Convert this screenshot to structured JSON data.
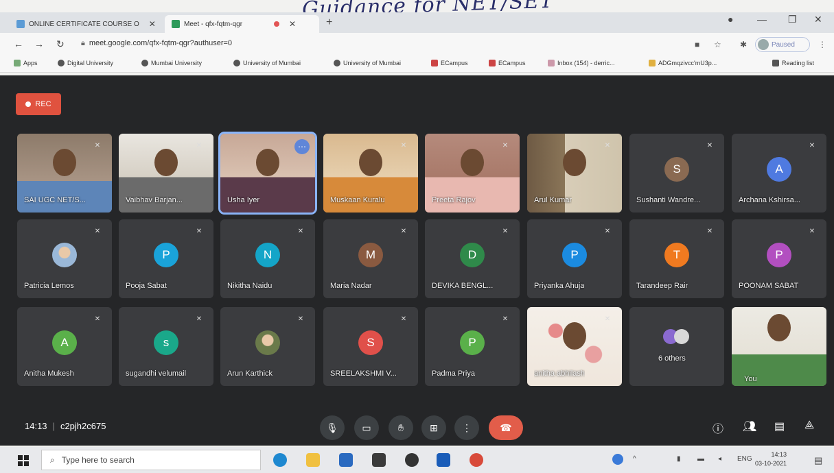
{
  "handwriting": "Guidance for NET/SET",
  "browser": {
    "tabs": [
      {
        "label": "ONLINE CERTIFICATE COURSE O",
        "favicon": "doc-icon",
        "color": "#5b9bd5"
      },
      {
        "label": "Meet - qfx-fqtm-qgr",
        "favicon": "meet-icon",
        "color": "#2e9a5a"
      }
    ],
    "url": "meet.google.com/qfx-fqtm-qgr?authuser=0",
    "profile_label": "Paused",
    "bookmarks": [
      {
        "label": "Apps",
        "icon": "apps-grid-icon"
      },
      {
        "label": "Digital University",
        "icon": "globe-icon"
      },
      {
        "label": "Mumbai University",
        "icon": "globe-icon"
      },
      {
        "label": "University of Mumbai",
        "icon": "globe-icon"
      },
      {
        "label": "University of Mumbai",
        "icon": "globe-icon"
      },
      {
        "label": "ECampus",
        "icon": "ecampus-icon"
      },
      {
        "label": "ECampus",
        "icon": "ecampus-icon"
      },
      {
        "label": "Inbox (154) - derric...",
        "icon": "gmail-icon"
      },
      {
        "label": "ADGmqzivcc'mU3p...",
        "icon": "drive-icon"
      },
      {
        "label": "Reading list",
        "icon": "reading-list-icon"
      }
    ]
  },
  "meet": {
    "rec_label": "REC",
    "meeting_time": "14:13",
    "meeting_code": "c2pjh2c675",
    "participants": [
      {
        "name": "SAI UGC NET/S...",
        "type": "video"
      },
      {
        "name": "Vaibhav Barjan...",
        "type": "video"
      },
      {
        "name": "Usha Iyer",
        "type": "video"
      },
      {
        "name": "Muskaan Kuralu",
        "type": "video"
      },
      {
        "name": "Preeta Rajov",
        "type": "video"
      },
      {
        "name": "Arul Kumar",
        "type": "video"
      },
      {
        "name": "Sushanti Wandre...",
        "type": "avatar",
        "initial": "S",
        "color": "#8a6a52"
      },
      {
        "name": "Archana Kshirsa...",
        "type": "avatar",
        "initial": "A",
        "color": "#4f7ae0"
      },
      {
        "name": "Patricia Lemos",
        "type": "photo",
        "color": "#9ab8d8"
      },
      {
        "name": "Pooja Sabat",
        "type": "avatar",
        "initial": "P",
        "color": "#1aa3d9"
      },
      {
        "name": "Nikitha Naidu",
        "type": "avatar",
        "initial": "N",
        "color": "#14a5c8"
      },
      {
        "name": "Maria Nadar",
        "type": "avatar",
        "initial": "M",
        "color": "#8a5a40"
      },
      {
        "name": "DEVIKA BENGL...",
        "type": "avatar",
        "initial": "D",
        "color": "#2f8a4a"
      },
      {
        "name": "Priyanka Ahuja",
        "type": "avatar",
        "initial": "P",
        "color": "#1b8be0"
      },
      {
        "name": "Tarandeep Rair",
        "type": "avatar",
        "initial": "T",
        "color": "#f07a20"
      },
      {
        "name": "POONAM SABAT",
        "type": "avatar",
        "initial": "P",
        "color": "#b24fc0"
      },
      {
        "name": "Anitha Mukesh",
        "type": "avatar",
        "initial": "A",
        "color": "#5ab04a"
      },
      {
        "name": "sugandhi velumail",
        "type": "avatar",
        "initial": "s",
        "color": "#1aa88a"
      },
      {
        "name": "Arun Karthick",
        "type": "photo",
        "color": "#6a7a4a"
      },
      {
        "name": "SREELAKSHMI V...",
        "type": "avatar",
        "initial": "S",
        "color": "#e0504a"
      },
      {
        "name": "Padma Priya",
        "type": "avatar",
        "initial": "P",
        "color": "#5ab04a"
      },
      {
        "name": "anitha abhilash",
        "type": "video"
      },
      {
        "name": "6 others",
        "type": "others"
      },
      {
        "name": "You",
        "type": "video"
      }
    ],
    "controls": [
      "mic-icon",
      "camera-icon",
      "raise-hand-icon",
      "present-icon",
      "more-options-icon",
      "end-call-icon"
    ],
    "right_controls": [
      "info-icon",
      "people-icon",
      "chat-icon",
      "activities-icon"
    ]
  },
  "taskbar": {
    "search_placeholder": "Type here to search",
    "clock_time": "14:13",
    "clock_date": "03-10-2021",
    "lang": "ENG"
  }
}
